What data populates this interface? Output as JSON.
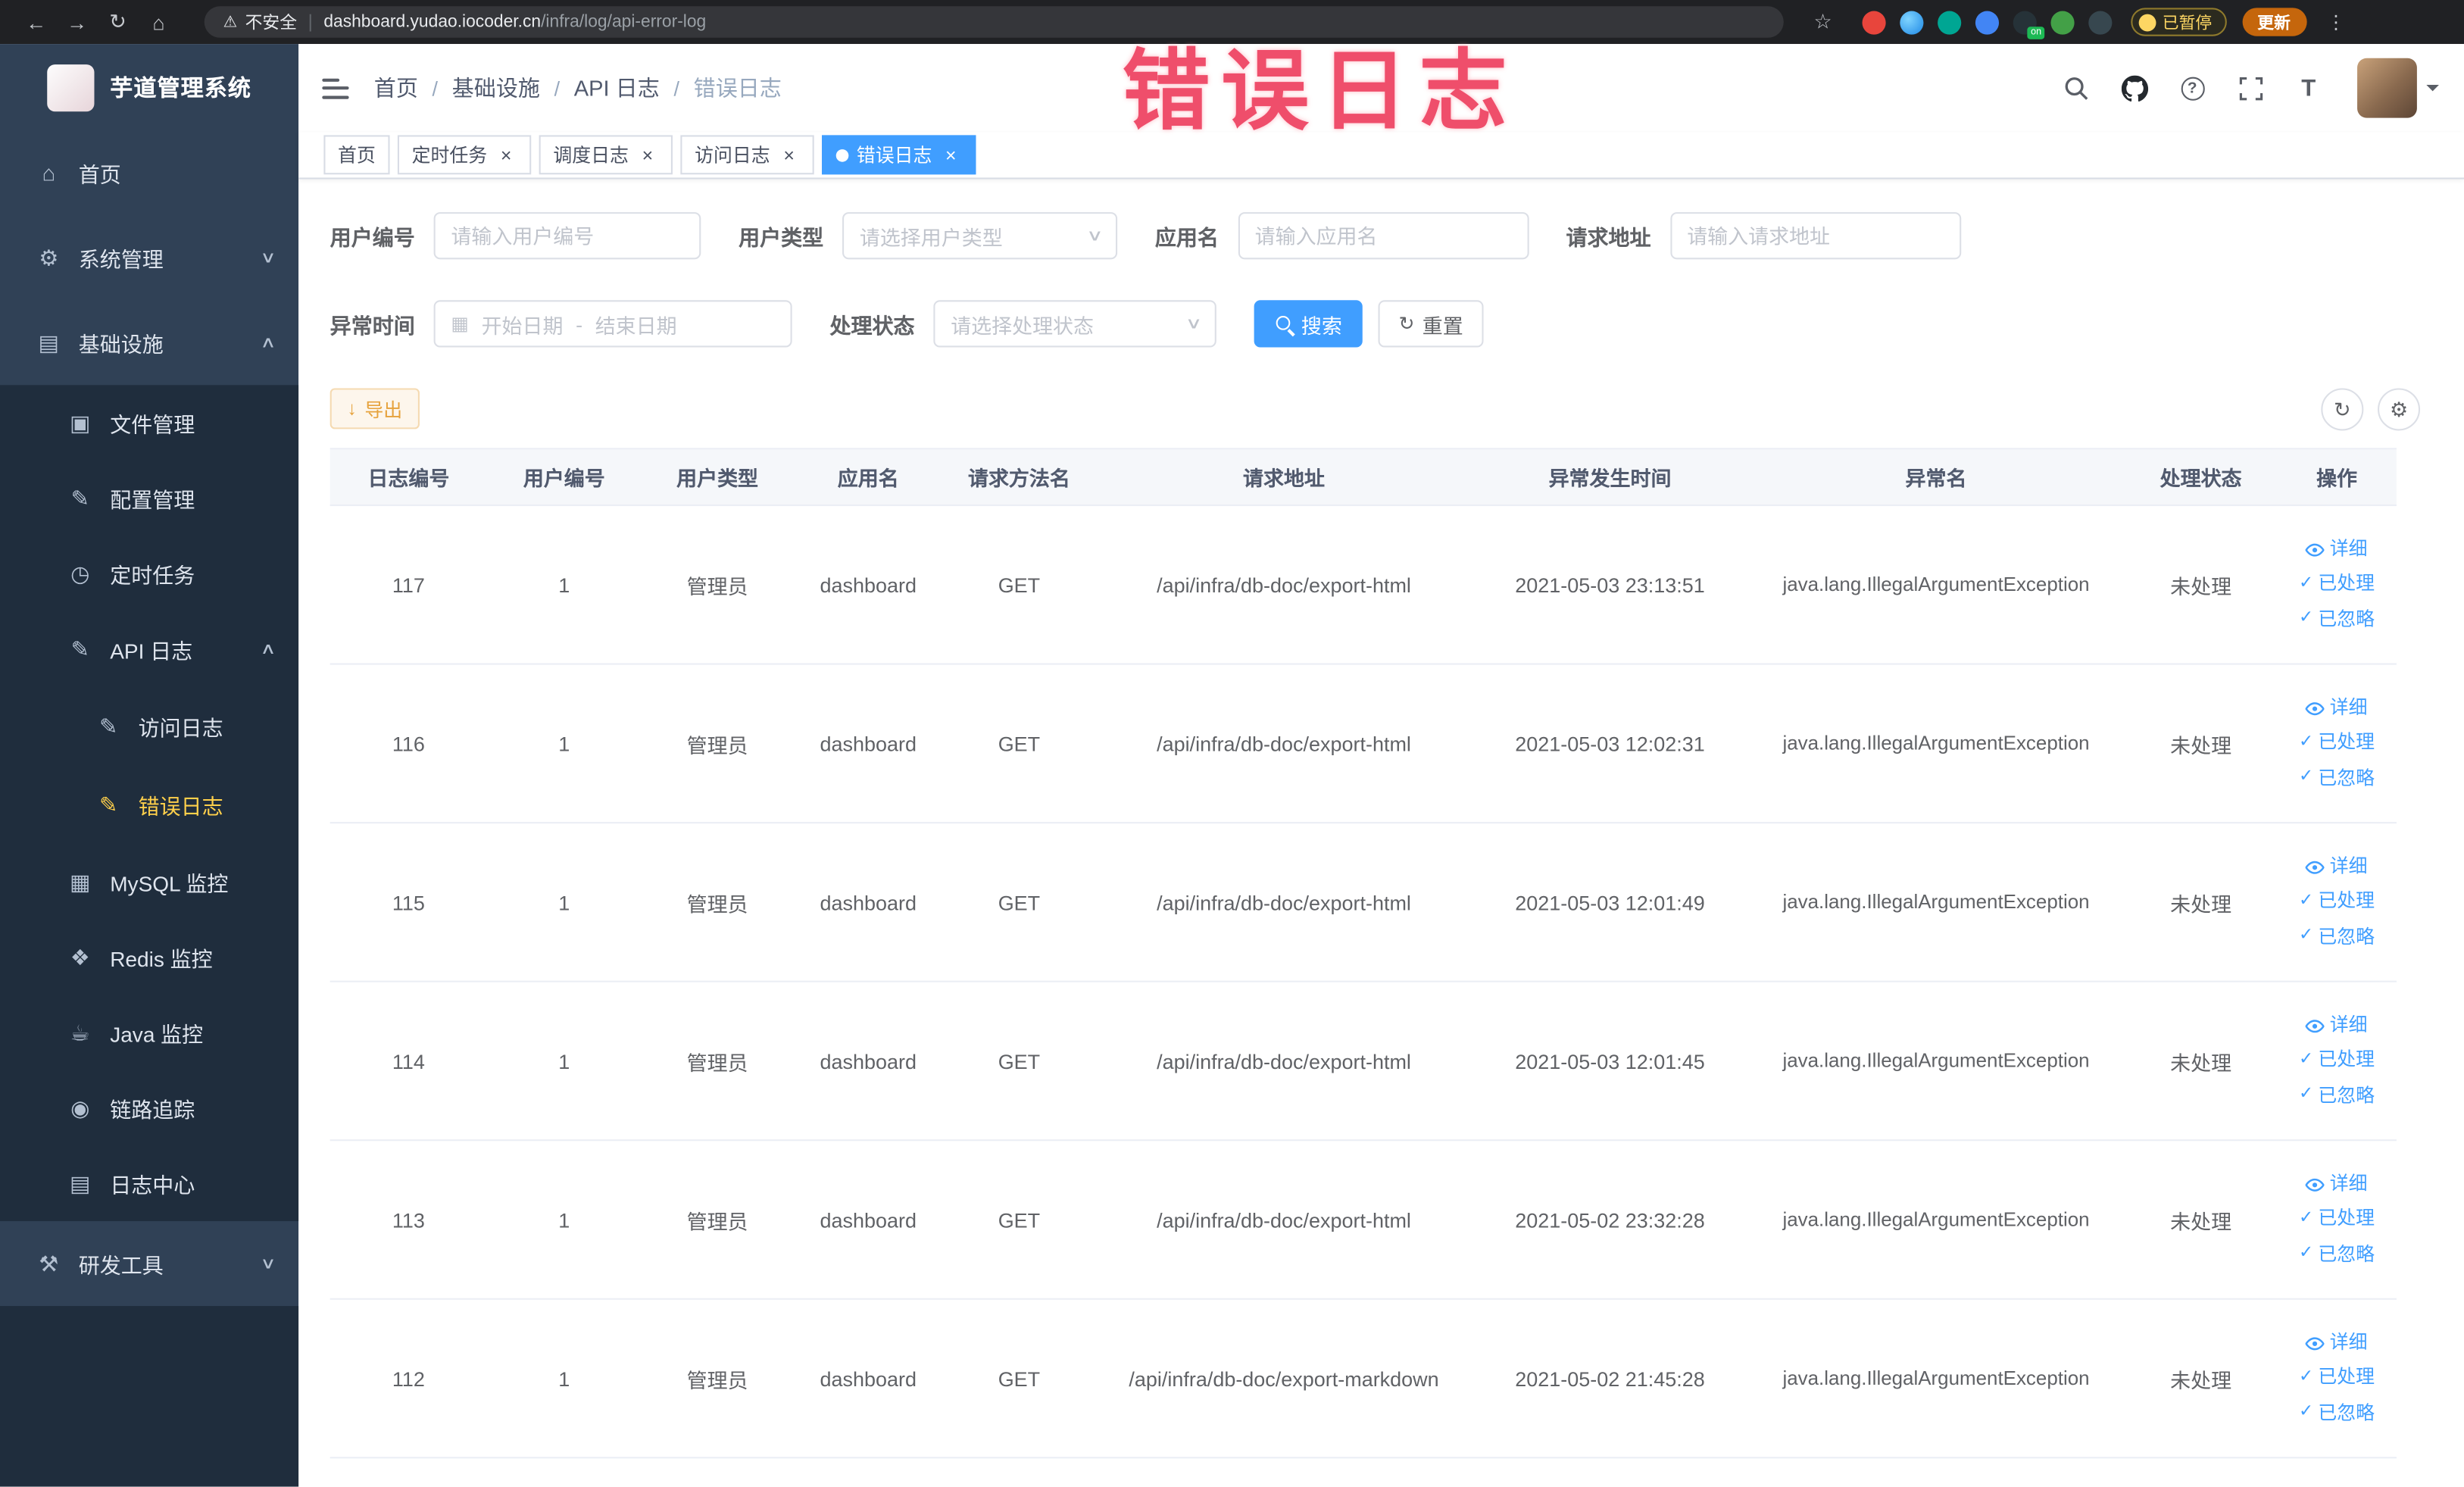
{
  "browser": {
    "security_label": "不安全",
    "url_host": "dashboard.yudao.iocoder.cn",
    "url_path": "/infra/log/api-error-log",
    "on_badge": "on",
    "paused_badge": "已暂停",
    "update_button": "更新"
  },
  "overlay": {
    "text": "错误日志"
  },
  "sidebar": {
    "logo_title": "芋道管理系统",
    "items": [
      {
        "label": "首页"
      },
      {
        "label": "系统管理"
      },
      {
        "label": "基础设施"
      },
      {
        "label": "文件管理"
      },
      {
        "label": "配置管理"
      },
      {
        "label": "定时任务"
      },
      {
        "label": "API 日志"
      },
      {
        "label": "访问日志"
      },
      {
        "label": "错误日志"
      },
      {
        "label": "MySQL 监控"
      },
      {
        "label": "Redis 监控"
      },
      {
        "label": "Java 监控"
      },
      {
        "label": "链路追踪"
      },
      {
        "label": "日志中心"
      },
      {
        "label": "研发工具"
      }
    ]
  },
  "header": {
    "breadcrumb": [
      "首页",
      "基础设施",
      "API 日志",
      "错误日志"
    ],
    "breadcrumb_separator": "/"
  },
  "tabs": [
    {
      "label": "首页"
    },
    {
      "label": "定时任务"
    },
    {
      "label": "调度日志"
    },
    {
      "label": "访问日志"
    },
    {
      "label": "错误日志"
    }
  ],
  "filters": {
    "user_id_label": "用户编号",
    "user_id_placeholder": "请输入用户编号",
    "user_type_label": "用户类型",
    "user_type_placeholder": "请选择用户类型",
    "app_name_label": "应用名",
    "app_name_placeholder": "请输入应用名",
    "request_url_label": "请求地址",
    "request_url_placeholder": "请输入请求地址",
    "exception_time_label": "异常时间",
    "date_start_placeholder": "开始日期",
    "date_separator": "-",
    "date_end_placeholder": "结束日期",
    "process_status_label": "处理状态",
    "process_status_placeholder": "请选择处理状态",
    "search_button": "搜索",
    "reset_button": "重置"
  },
  "toolbar": {
    "export_button": "导出"
  },
  "table": {
    "columns": [
      "日志编号",
      "用户编号",
      "用户类型",
      "应用名",
      "请求方法名",
      "请求地址",
      "异常发生时间",
      "异常名",
      "处理状态",
      "操作"
    ],
    "actions": [
      "详细",
      "已处理",
      "已忽略"
    ],
    "rows": [
      {
        "id": "117",
        "uid": "1",
        "utype": "管理员",
        "app": "dashboard",
        "method": "GET",
        "url": "/api/infra/db-doc/export-html",
        "time": "2021-05-03 23:13:51",
        "exc": "java.lang.IllegalArgumentException",
        "status": "未处理"
      },
      {
        "id": "116",
        "uid": "1",
        "utype": "管理员",
        "app": "dashboard",
        "method": "GET",
        "url": "/api/infra/db-doc/export-html",
        "time": "2021-05-03 12:02:31",
        "exc": "java.lang.IllegalArgumentException",
        "status": "未处理"
      },
      {
        "id": "115",
        "uid": "1",
        "utype": "管理员",
        "app": "dashboard",
        "method": "GET",
        "url": "/api/infra/db-doc/export-html",
        "time": "2021-05-03 12:01:49",
        "exc": "java.lang.IllegalArgumentException",
        "status": "未处理"
      },
      {
        "id": "114",
        "uid": "1",
        "utype": "管理员",
        "app": "dashboard",
        "method": "GET",
        "url": "/api/infra/db-doc/export-html",
        "time": "2021-05-03 12:01:45",
        "exc": "java.lang.IllegalArgumentException",
        "status": "未处理"
      },
      {
        "id": "113",
        "uid": "1",
        "utype": "管理员",
        "app": "dashboard",
        "method": "GET",
        "url": "/api/infra/db-doc/export-html",
        "time": "2021-05-02 23:32:28",
        "exc": "java.lang.IllegalArgumentException",
        "status": "未处理"
      },
      {
        "id": "112",
        "uid": "1",
        "utype": "管理员",
        "app": "dashboard",
        "method": "GET",
        "url": "/api/infra/db-doc/export-markdown",
        "time": "2021-05-02 21:45:28",
        "exc": "java.lang.IllegalArgumentException",
        "status": "未处理"
      }
    ]
  },
  "icons": {
    "back": "←",
    "forward": "→",
    "reload": "↻",
    "home": "⌂",
    "warning": "⚠",
    "star": "☆",
    "kebab": "⋮",
    "close": "×",
    "check": "✓",
    "chevron_down": "∨",
    "chevron_up": "∧",
    "question": "?",
    "calendar": "▦",
    "refresh": "↻",
    "settings": "⚙",
    "export": "↓",
    "reset": "↻",
    "font_size": "T",
    "menu_home": "⌂",
    "menu_system": "⚙",
    "menu_infra": "▤",
    "menu_file": "▣",
    "menu_config": "✎",
    "menu_job": "◷",
    "menu_api": "✎",
    "menu_access": "✎",
    "menu_error": "✎",
    "menu_mysql": "▦",
    "menu_redis": "❖",
    "menu_java": "☕",
    "menu_trace": "◉",
    "menu_logcenter": "▤",
    "menu_tools": "⚒"
  },
  "colors": {
    "accent": "#409eff",
    "sidebar_bg": "#304156",
    "submenu_bg": "#1f2d3d",
    "active_menu_text": "#ffd04b",
    "warning": "#e6a23c",
    "overlay_red": "#ee4160"
  }
}
